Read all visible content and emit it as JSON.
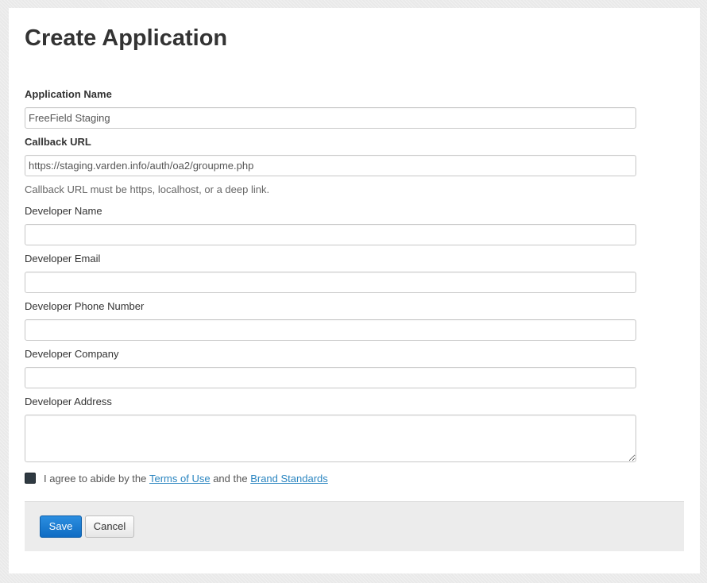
{
  "page": {
    "title": "Create Application"
  },
  "form": {
    "app_name": {
      "label": "Application Name",
      "value": "FreeField Staging"
    },
    "callback_url": {
      "label": "Callback URL",
      "value": "https://staging.varden.info/auth/oa2/groupme.php",
      "help": "Callback URL must be https, localhost, or a deep link."
    },
    "developer_name": {
      "label": "Developer Name",
      "value": ""
    },
    "developer_email": {
      "label": "Developer Email",
      "value": ""
    },
    "developer_phone": {
      "label": "Developer Phone Number",
      "value": ""
    },
    "developer_company": {
      "label": "Developer Company",
      "value": ""
    },
    "developer_address": {
      "label": "Developer Address",
      "value": ""
    },
    "agree": {
      "checked": true,
      "text_before": "I agree to abide by the",
      "terms_link": "Terms of Use",
      "text_middle": "and the",
      "brand_link": "Brand Standards"
    }
  },
  "actions": {
    "save_label": "Save",
    "cancel_label": "Cancel"
  },
  "colors": {
    "primary": "#0f6cc3",
    "link": "#2a85c0",
    "checkbox": "#2f3a42"
  }
}
